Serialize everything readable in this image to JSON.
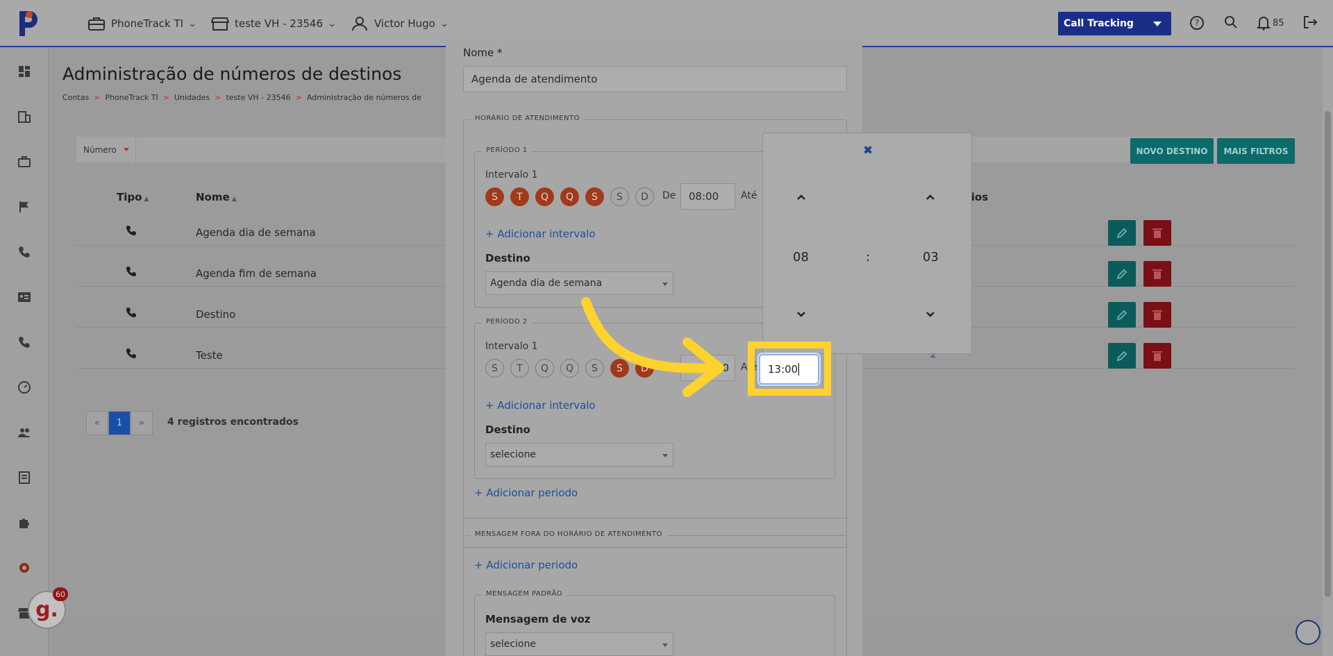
{
  "topbar": {
    "account": "PhoneTrack TI",
    "unit": "teste VH - 23546",
    "user": "Victor Hugo",
    "product_select": "Call Tracking",
    "notifications_count": "85"
  },
  "page": {
    "title": "Administração de números de destinos",
    "breadcrumb": [
      "Contas",
      "PhoneTrack TI",
      "Unidades",
      "teste VH - 23546",
      "Administração de números de"
    ],
    "filter_label": "Número",
    "new_button": "NOVO DESTINO",
    "more_filters_button": "MAIS FILTROS",
    "columns": {
      "tipo": "Tipo",
      "nome": "Nome",
      "extra": "cios"
    },
    "rows": [
      {
        "name": "Agenda dia de semana"
      },
      {
        "name": "Agenda fim de semana"
      },
      {
        "name": "Destino"
      },
      {
        "name": "Teste",
        "count": "2"
      }
    ],
    "pager": {
      "prev": "«",
      "current": "1",
      "next": "»"
    },
    "records_text": "4 registros encontrados"
  },
  "modal": {
    "name_label": "Nome *",
    "name_value": "Agenda de atendimento",
    "hours_legend": "HORÁRIO DE ATENDIMENTO",
    "period1": {
      "legend": "PERÍODO 1",
      "interval_label": "Intervalo 1",
      "days": [
        "S",
        "T",
        "Q",
        "Q",
        "S",
        "S",
        "D"
      ],
      "days_active": [
        true,
        true,
        true,
        true,
        true,
        false,
        false
      ],
      "from_label": "De",
      "from_value": "08:00",
      "to_label": "Até",
      "add_interval": "+ Adicionar intervalo",
      "dest_label": "Destino",
      "dest_value": "Agenda dia de semana"
    },
    "period2": {
      "legend": "PERÍODO 2",
      "interval_label": "Intervalo 1",
      "days": [
        "S",
        "T",
        "Q",
        "Q",
        "S",
        "S",
        "D"
      ],
      "days_active": [
        false,
        false,
        false,
        false,
        false,
        true,
        true
      ],
      "from_value_partial": "0",
      "to_label": "Até",
      "to_value": "13:00",
      "add_interval": "+ Adicionar intervalo",
      "dest_label": "Destino",
      "dest_value": "selecione"
    },
    "add_period": "+ Adicionar periodo",
    "out_hours_legend": "MENSAGEM FORA DO HORÁRIO DE ATENDIMENTO",
    "add_period2": "+ Adicionar periodo",
    "default_msg_legend": "MENSAGEM PADRÃO",
    "voice_msg_label": "Mensagem de voz",
    "voice_msg_value": "selecione"
  },
  "time_picker": {
    "close": "✖",
    "hours": "08",
    "separator": ":",
    "minutes": "03"
  },
  "badge": {
    "letter": "g.",
    "count": "60"
  },
  "colors": {
    "brand_blue": "#192e86",
    "highlight": "#ffd22e",
    "day_active": "#a03a1b",
    "teal": "#0d6a6a",
    "danger": "#7a0f16"
  }
}
